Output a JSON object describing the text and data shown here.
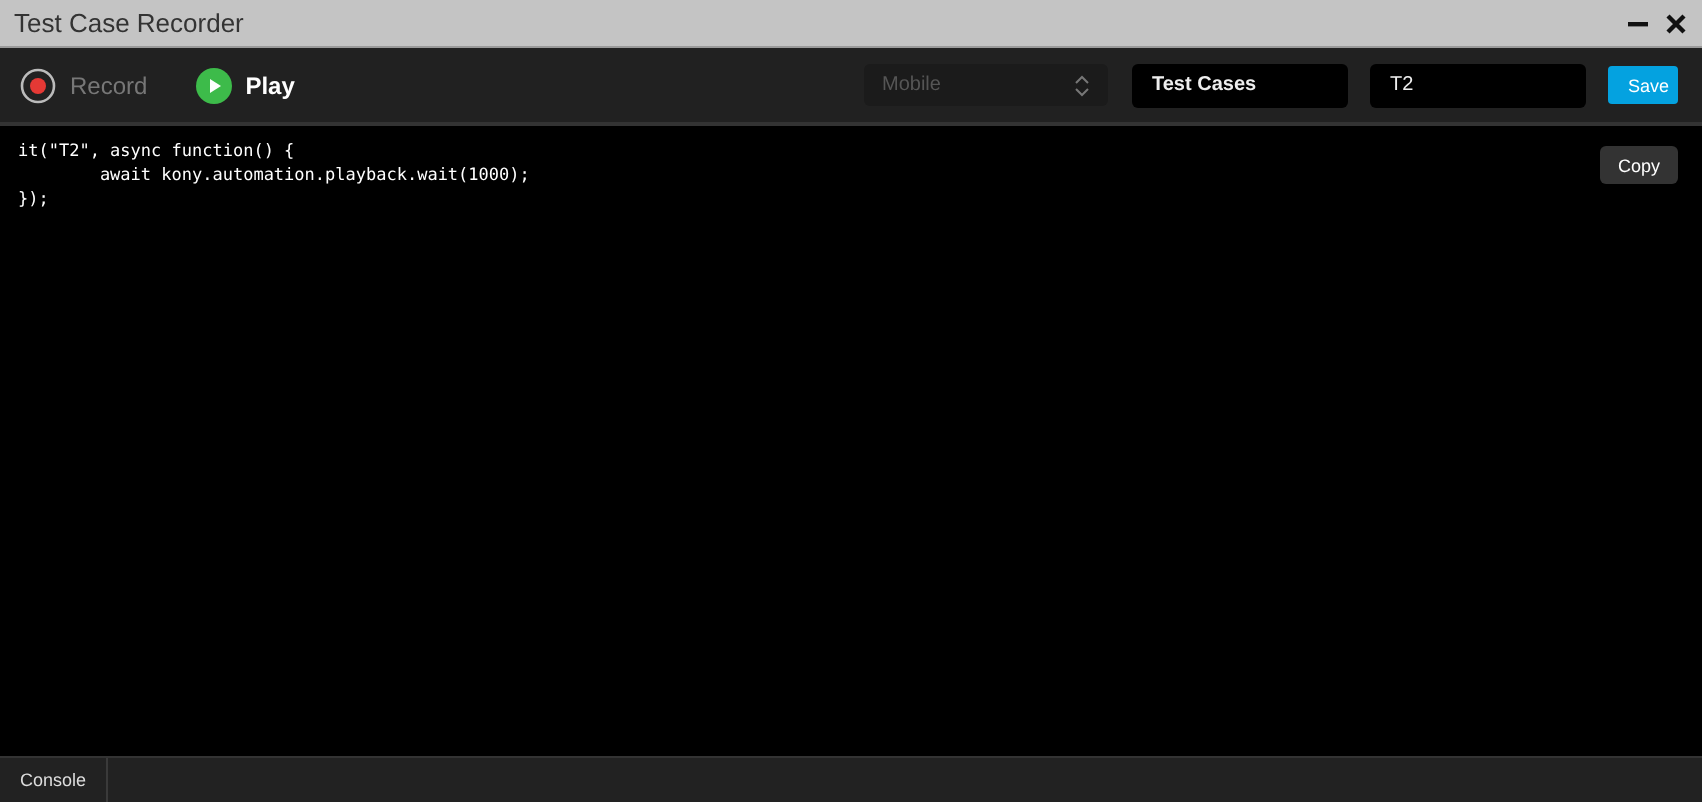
{
  "window": {
    "title": "Test Case Recorder",
    "controls": [
      {
        "kind": "minimize"
      },
      {
        "kind": "close"
      }
    ]
  },
  "toolbar": {
    "record": {
      "label": "Record",
      "disabled": true
    },
    "play": {
      "label": "Play",
      "disabled": false
    },
    "platform": {
      "value": "Mobile",
      "disabled": true
    },
    "suite": {
      "value": "Test Cases"
    },
    "test_name": {
      "value": "T2"
    },
    "save": {
      "label": "Save"
    }
  },
  "code": {
    "lines": [
      "it(\"T2\", async function() {",
      "        await kony.automation.playback.wait(1000);",
      "});"
    ],
    "copy": {
      "label": "Copy"
    }
  },
  "bottom_tabs": [
    {
      "label": "Console"
    }
  ]
}
